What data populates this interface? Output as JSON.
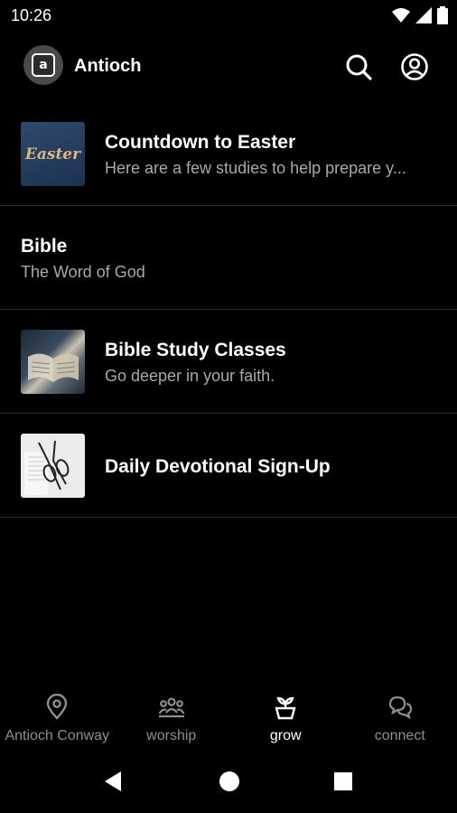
{
  "status": {
    "time": "10:26"
  },
  "header": {
    "logo_letter": "a",
    "title": "Antioch",
    "search_icon": "search-icon",
    "account_icon": "account-icon"
  },
  "list": [
    {
      "title": "Countdown to Easter",
      "subtitle": "Here are a few studies to help prepare y...",
      "thumb_text": "Easter"
    },
    {
      "title": "Bible",
      "subtitle": "The Word of God"
    },
    {
      "title": "Bible Study Classes",
      "subtitle": "Go deeper in your faith."
    },
    {
      "title": "Daily Devotional Sign-Up"
    }
  ],
  "nav": [
    {
      "label": "Antioch Conway",
      "icon": "location-pin-icon",
      "active": false
    },
    {
      "label": "worship",
      "icon": "people-group-icon",
      "active": false
    },
    {
      "label": "grow",
      "icon": "sprout-pot-icon",
      "active": true
    },
    {
      "label": "connect",
      "icon": "chat-bubbles-icon",
      "active": false
    }
  ],
  "colors": {
    "background": "#000000",
    "text": "#ffffff",
    "secondary_text": "#a9a9a9",
    "inactive_nav": "#8e8e8e"
  }
}
